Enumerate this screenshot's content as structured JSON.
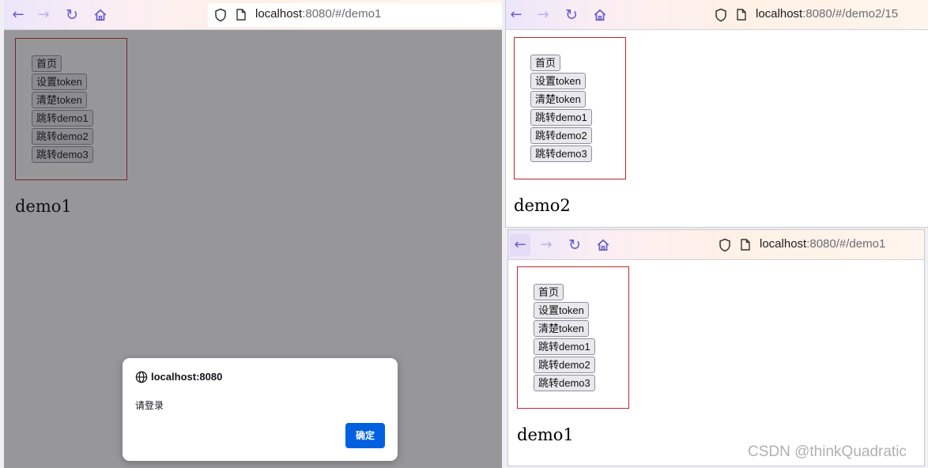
{
  "windows": [
    {
      "url_host": "localhost",
      "url_rest": ":8080/#/demo1",
      "buttons": [
        "首页",
        "设置token",
        "清楚token",
        "跳转demo1",
        "跳转demo2",
        "跳转demo3"
      ],
      "page_title": "demo1",
      "dialog": {
        "origin": "localhost:8080",
        "message": "请登录",
        "ok_label": "确定"
      }
    },
    {
      "url_host": "localhost",
      "url_rest": ":8080/#/demo2/15",
      "buttons": [
        "首页",
        "设置token",
        "清楚token",
        "跳转demo1",
        "跳转demo2",
        "跳转demo3"
      ],
      "page_title": "demo2"
    },
    {
      "url_host": "localhost",
      "url_rest": ":8080/#/demo1",
      "buttons": [
        "首页",
        "设置token",
        "清楚token",
        "跳转demo1",
        "跳转demo2",
        "跳转demo3"
      ],
      "page_title": "demo1"
    }
  ],
  "icons": {
    "back": "back-arrow-icon",
    "forward": "forward-arrow-icon",
    "reload": "reload-icon",
    "home": "home-icon",
    "shield": "shield-icon",
    "page": "page-icon",
    "globe": "globe-icon"
  },
  "colors": {
    "frame_border": "#c2262b",
    "dialog_button": "#0061e0",
    "nav_icon": "#6a5fc9"
  },
  "watermark": "CSDN @thinkQuadratic"
}
